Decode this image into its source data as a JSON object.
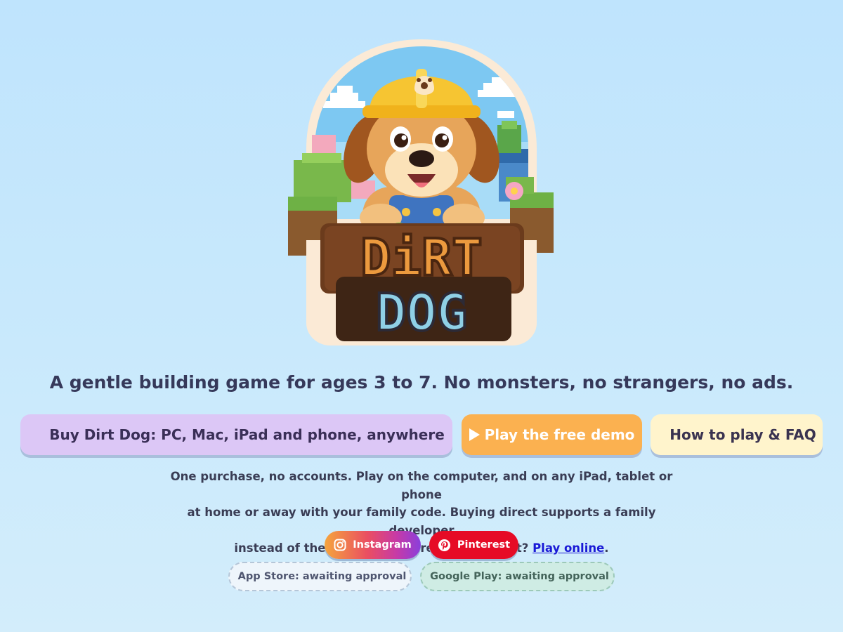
{
  "logo": {
    "word_top": "DiRT",
    "word_bottom": "DOG"
  },
  "tagline": "A gentle building game for ages 3 to 7. No monsters, no strangers, no ads.",
  "buttons": {
    "buy": "Buy Dirt Dog: PC, Mac, iPad and phone, anywhere",
    "demo": "Play the free demo",
    "faq": "How to play & FAQ"
  },
  "info": {
    "line1": "One purchase, no accounts. Play on the computer, and on any iPad, tablet or phone",
    "line2": "at home or away with your family code. Buying direct supports a family developer",
    "line3_prefix": "instead of the app stores. Already bought it?",
    "link": "Play online",
    "line3_suffix": "."
  },
  "social": {
    "instagram": "Instagram",
    "pinterest": "Pinterest"
  },
  "stores": {
    "apple": "App Store: awaiting approval",
    "google": "Google Play: awaiting approval"
  },
  "colors": {
    "background": "#c4e6fc",
    "buy_button": "#dcc7f6",
    "demo_button": "#fbb150",
    "faq_button": "#fff4cc",
    "pinterest": "#e60b26",
    "link": "#1a19d6"
  },
  "icons": {
    "demo": "play-icon",
    "instagram": "instagram-icon",
    "pinterest": "pinterest-icon",
    "logo": "dirt-dog-logo"
  }
}
